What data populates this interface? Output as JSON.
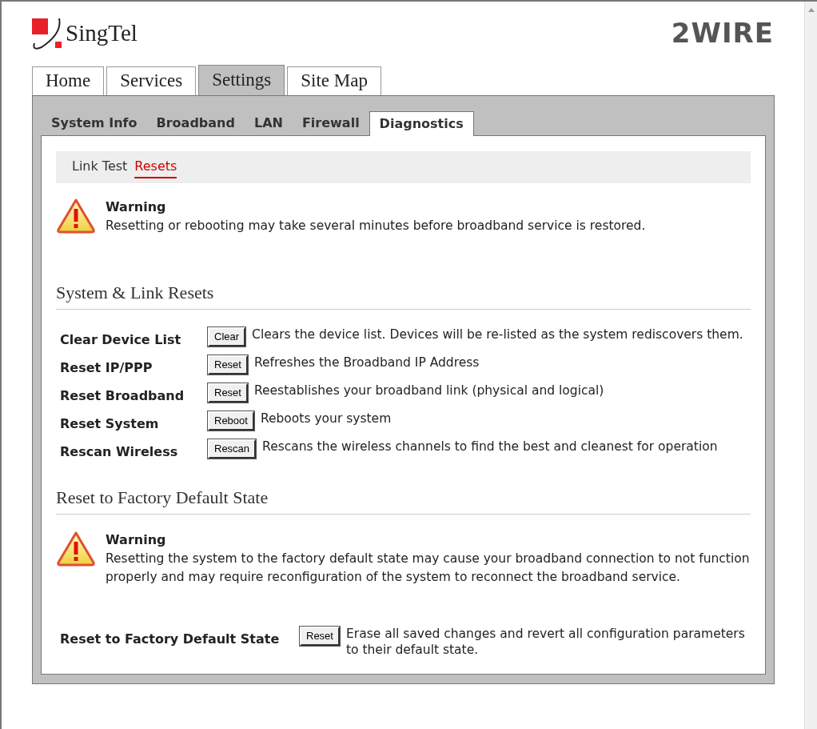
{
  "header": {
    "brand": "SingTel",
    "partner_logo": "2WIRE"
  },
  "tabs": [
    {
      "label": "Home",
      "selected": false
    },
    {
      "label": "Services",
      "selected": false
    },
    {
      "label": "Settings",
      "selected": true
    },
    {
      "label": "Site Map",
      "selected": false
    }
  ],
  "subtabs": [
    {
      "label": "System Info",
      "selected": false
    },
    {
      "label": "Broadband",
      "selected": false
    },
    {
      "label": "LAN",
      "selected": false
    },
    {
      "label": "Firewall",
      "selected": false
    },
    {
      "label": "Diagnostics",
      "selected": true
    }
  ],
  "links": [
    {
      "label": "Link Test",
      "selected": false
    },
    {
      "label": "Resets",
      "selected": true
    }
  ],
  "warning": {
    "title": "Warning",
    "text": "Resetting or rebooting may take several minutes before broadband service is restored."
  },
  "sections": [
    {
      "title": "System & Link Resets",
      "rows": [
        {
          "label": "Clear Device List",
          "button": "Clear",
          "description": "Clears the device list. Devices will be re-listed as the system rediscovers them."
        },
        {
          "label": "Reset IP/PPP",
          "button": "Reset",
          "description": "Refreshes the Broadband IP Address"
        },
        {
          "label": "Reset Broadband",
          "button": "Reset",
          "description": "Reestablishes your broadband link (physical and logical)"
        },
        {
          "label": "Reset System",
          "button": "Reboot",
          "description": "Reboots your system"
        },
        {
          "label": "Rescan Wireless",
          "button": "Rescan",
          "description": "Rescans the wireless channels to find the best and cleanest for operation"
        }
      ]
    },
    {
      "title": "Reset to Factory Default State",
      "warning": {
        "title": "Warning",
        "text": "Resetting the system to the factory default state may cause your broadband connection to not function properly and may require reconfiguration of the system to reconnect the broadband service."
      },
      "rows": [
        {
          "label": "Reset to Factory Default State",
          "button": "Reset",
          "description": "Erase all saved changes and revert all configuration parameters to their default state."
        }
      ]
    }
  ]
}
